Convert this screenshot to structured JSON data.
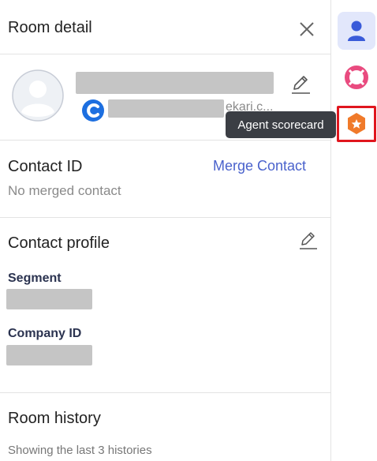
{
  "header": {
    "title": "Room detail"
  },
  "contact": {
    "email_suffix": "ekari.c..."
  },
  "contact_id": {
    "heading": "Contact ID",
    "merge_label": "Merge Contact",
    "status": "No merged contact"
  },
  "profile": {
    "heading": "Contact profile",
    "fields": [
      {
        "label": "Segment"
      },
      {
        "label": "Company ID"
      }
    ]
  },
  "history": {
    "heading": "Room history",
    "subtitle": "Showing the last 3 histories"
  },
  "rail": {
    "tooltip": "Agent scorecard"
  },
  "colors": {
    "accent": "#4a62cc",
    "rail_active_bg": "#e2e7fb",
    "scorecard_orange": "#f07a2a",
    "highlight_red": "#e0161e",
    "lifebuoy_pink": "#e94b7f"
  }
}
